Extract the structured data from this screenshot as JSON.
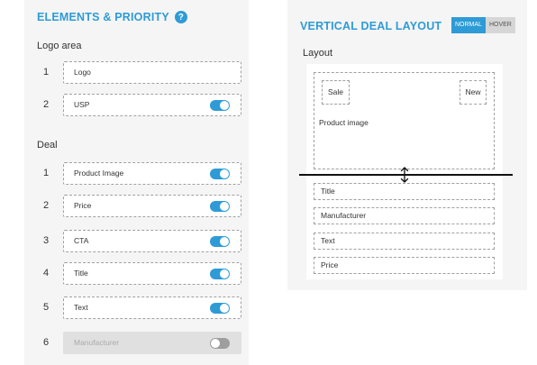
{
  "elements_panel": {
    "heading": "ELEMENTS & PRIORITY",
    "help_glyph": "?",
    "logo_area": {
      "label": "Logo area",
      "rows": [
        {
          "num": "1",
          "label": "Logo",
          "toggle": null
        },
        {
          "num": "2",
          "label": "USP",
          "toggle": "on"
        }
      ]
    },
    "deal": {
      "label": "Deal",
      "rows": [
        {
          "num": "1",
          "label": "Product Image",
          "toggle": "on"
        },
        {
          "num": "2",
          "label": "Price",
          "toggle": "on"
        },
        {
          "num": "3",
          "label": "CTA",
          "toggle": "on"
        },
        {
          "num": "4",
          "label": "Title",
          "toggle": "on"
        },
        {
          "num": "5",
          "label": "Text",
          "toggle": "on"
        },
        {
          "num": "6",
          "label": "Manufacturer",
          "toggle": "off"
        }
      ]
    }
  },
  "layout_panel": {
    "heading": "VERTICAL DEAL LAYOUT",
    "modes": [
      {
        "label": "NORMAL",
        "active": true
      },
      {
        "label": "HOVER",
        "active": false
      }
    ],
    "layout_label": "Layout",
    "image_box": {
      "label": "Product image",
      "badges": {
        "left": "Sale",
        "right": "New"
      }
    },
    "stack": [
      "Title",
      "Manufacturer",
      "Text",
      "Price"
    ]
  },
  "colors": {
    "accent": "#2e9bd6",
    "panel_bg": "#f5f5f5",
    "toggle_off": "#9e9e9e"
  },
  "icons": {
    "help": "help-icon",
    "resize": "resize-vertical-icon"
  }
}
